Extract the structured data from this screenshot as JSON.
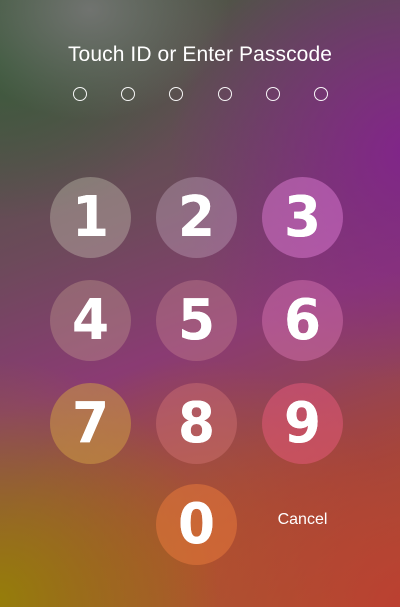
{
  "header": {
    "title": "Touch ID or Enter Passcode",
    "passcode_length": 6,
    "entered": 0
  },
  "keypad": {
    "keys": [
      {
        "digit": "1"
      },
      {
        "digit": "2"
      },
      {
        "digit": "3"
      },
      {
        "digit": "4"
      },
      {
        "digit": "5"
      },
      {
        "digit": "6"
      },
      {
        "digit": "7"
      },
      {
        "digit": "8"
      },
      {
        "digit": "9"
      },
      {
        "digit": "0"
      }
    ],
    "cancel_label": "Cancel"
  }
}
